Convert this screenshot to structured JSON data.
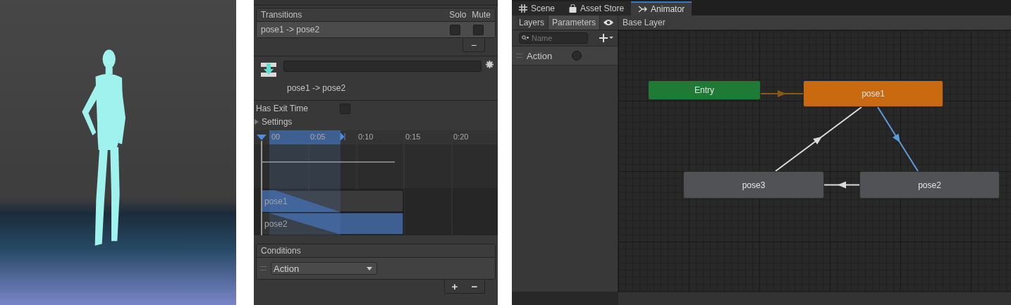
{
  "inspector": {
    "transitions": {
      "title": "Transitions",
      "columns": [
        "Solo",
        "Mute"
      ],
      "rows": [
        {
          "name": "pose1 -> pose2",
          "selected": true,
          "solo": false,
          "mute": false
        }
      ],
      "remove_button": "−"
    },
    "transition_name": "pose1 -> pose2",
    "has_exit_time": {
      "label": "Has Exit Time",
      "checked": false
    },
    "settings": {
      "label": "Settings",
      "expanded": false
    },
    "timeline": {
      "ticks": [
        "00",
        "0:05",
        "0:10",
        "0:15",
        "0:20"
      ],
      "clips": [
        "pose1",
        "pose2"
      ]
    },
    "conditions": {
      "title": "Conditions",
      "items": [
        {
          "parameter": "Action"
        }
      ],
      "add_button": "+",
      "remove_button": "−"
    }
  },
  "animator": {
    "tabs": [
      {
        "label": "Scene",
        "selected": false
      },
      {
        "label": "Asset Store",
        "selected": false
      },
      {
        "label": "Animator",
        "selected": true
      }
    ],
    "toolbar_tabs": [
      {
        "label": "Layers",
        "selected": false
      },
      {
        "label": "Parameters",
        "selected": true
      }
    ],
    "breadcrumb": "Base Layer",
    "search": {
      "placeholder": "Name"
    },
    "parameters": [
      {
        "name": "Action",
        "kind": "bool",
        "value": false
      }
    ],
    "nodes": [
      {
        "label": "Entry",
        "kind": "entry"
      },
      {
        "label": "pose1",
        "kind": "default"
      },
      {
        "label": "pose3",
        "kind": "state"
      },
      {
        "label": "pose2",
        "kind": "state"
      }
    ],
    "transitions": [
      {
        "kind": "entry",
        "selected": false
      },
      {
        "kind": "state",
        "selected": true
      },
      {
        "kind": "state",
        "selected": false
      },
      {
        "kind": "state",
        "selected": false
      }
    ]
  }
}
